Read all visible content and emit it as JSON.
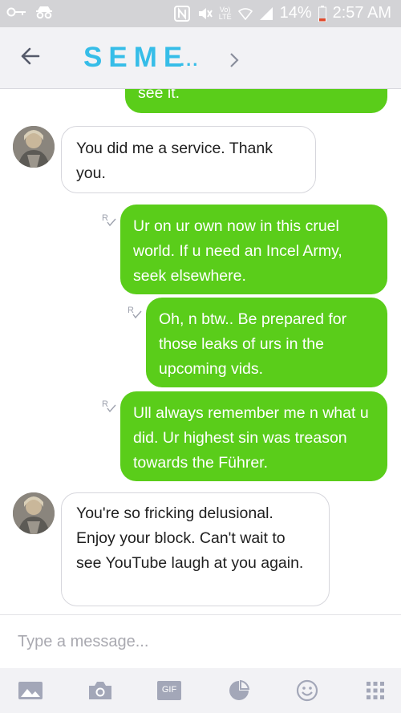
{
  "status": {
    "battery": "14%",
    "time": "2:57 AM",
    "network": "LTE",
    "carrier_tag": "Vo)"
  },
  "header": {
    "title": "SEME",
    "title_ellipsis": "..."
  },
  "messages": [
    {
      "direction": "out",
      "text": "see it."
    },
    {
      "direction": "in",
      "text": "You did me a service. Thank you."
    },
    {
      "direction": "out",
      "text": "Ur on ur own now in this cruel world. If u need an Incel Army, seek elsewhere."
    },
    {
      "direction": "out",
      "text": "Oh, n btw.. Be prepared for those leaks of urs in the upcoming vids."
    },
    {
      "direction": "out",
      "text": "Ull always remember me n what u did. Ur highest sin was treason towards the Führer."
    },
    {
      "direction": "in",
      "text": "You're so fricking delusional. Enjoy your block. Can't wait to see YouTube laugh at you again."
    }
  ],
  "composer": {
    "placeholder": "Type a message..."
  },
  "toolbar": {
    "gif_label": "GIF"
  },
  "colors": {
    "accent": "#36bde8",
    "outgoing": "#5acd1a",
    "icon": "#a3a7b8"
  }
}
